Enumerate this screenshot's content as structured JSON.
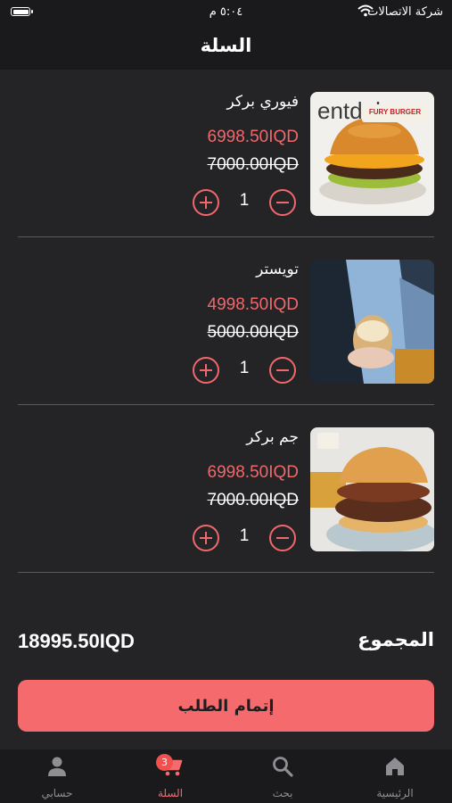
{
  "status_bar": {
    "carrier": "شركة الاتصالات",
    "time": "٥:٠٤ م"
  },
  "header": {
    "title": "السلة"
  },
  "cart_items": [
    {
      "name": "فيوري بركر",
      "price": "6998.50IQD",
      "old_price": "7000.00IQD",
      "quantity": "1",
      "image_caption": "FURY BURGER"
    },
    {
      "name": "تويستر",
      "price": "4998.50IQD",
      "old_price": "5000.00IQD",
      "quantity": "1"
    },
    {
      "name": "جم بركر",
      "price": "6998.50IQD",
      "old_price": "7000.00IQD",
      "quantity": "1"
    }
  ],
  "summary": {
    "total_label": "المجموع",
    "total_value": "18995.50IQD"
  },
  "checkout": {
    "label": "إتمام الطلب"
  },
  "tab_bar": {
    "items": [
      {
        "label": "الرئيسية",
        "icon": "home-icon"
      },
      {
        "label": "بحث",
        "icon": "search-icon"
      },
      {
        "label": "السلة",
        "icon": "cart-icon",
        "badge": "3",
        "active": true
      },
      {
        "label": "حسابي",
        "icon": "person-icon"
      }
    ]
  },
  "colors": {
    "background": "#242427",
    "bars": "#1a1a1c",
    "accent": "#f56a6d",
    "price": "#f0686b",
    "badge": "#f2504f",
    "inactive_tab": "#8e8e93"
  }
}
